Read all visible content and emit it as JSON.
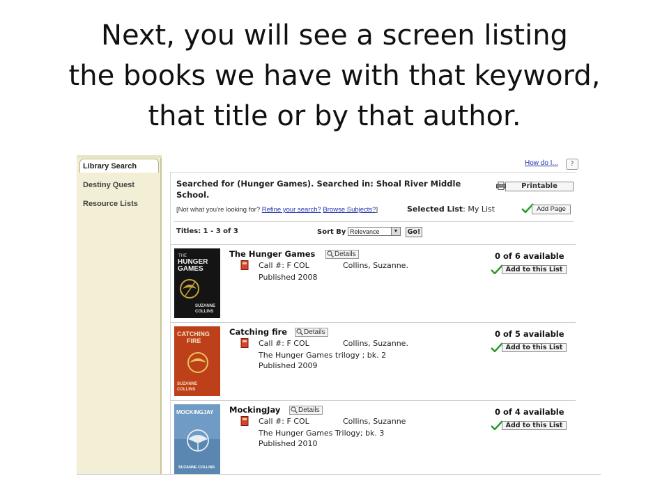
{
  "slide": {
    "title_lines": [
      "Next, you will see a screen listing",
      "the books we have with that keyword,",
      "that title or by that author."
    ]
  },
  "sidebar": {
    "items": [
      {
        "label": "Library Search",
        "active": true
      },
      {
        "label": "Destiny Quest"
      },
      {
        "label": "Resource Lists"
      }
    ]
  },
  "header": {
    "help_link": "How do I...",
    "help_icon": "?"
  },
  "search": {
    "searched_for": "Searched for (Hunger Games). Searched in: Shoal River Middle School.",
    "printable_label": "Printable",
    "not_what_prefix": "[Not what you're looking for? ",
    "refine_link": "Refine your search?",
    "browse_link": "Browse Subjects?",
    "not_what_suffix": "]",
    "selected_list_label": "Selected List",
    "selected_list_value": ": My List",
    "add_page_label": "Add Page",
    "titles_count": "Titles: 1 - 3 of 3",
    "sort_by_label": "Sort By",
    "sort_value": "Relevance",
    "go_label": "Go!"
  },
  "results": [
    {
      "title": "The Hunger Games",
      "details_label": "Details",
      "call_number": "Call #: F COL",
      "author": "Collins, Suzanne.",
      "series": "",
      "published": "Published 2008",
      "availability": "0 of 6 available",
      "add_label": "Add to this List",
      "cover": {
        "lines": [
          "THE",
          "HUNGER",
          "GAMES"
        ],
        "author": "SUZANNE COLLINS",
        "color": "#141414",
        "text_color": "#f2f2f2"
      }
    },
    {
      "title": "Catching fire",
      "details_label": "Details",
      "call_number": "Call #: F COL",
      "author": "Collins, Suzanne.",
      "series": "The Hunger Games trilogy ; bk. 2",
      "published": "Published 2009",
      "availability": "0 of 5 available",
      "add_label": "Add to this List",
      "cover": {
        "lines": [
          "CATCHING",
          "FIRE"
        ],
        "author": "SUZANNE COLLINS",
        "color": "#b3321b",
        "text_color": "#f4e2c0"
      }
    },
    {
      "title": "MockingJay",
      "details_label": "Details",
      "call_number": "Call #: F COL",
      "author": "Collins, Suzanne",
      "series": "The Hunger Games Trilogy; bk. 3",
      "published": "Published 2010",
      "availability": "0 of 4 available",
      "add_label": "Add to this List",
      "cover": {
        "lines": [
          "MOCKINGJAY"
        ],
        "author": "SUZANNE COLLINS",
        "color": "#6f9bc4",
        "text_color": "#ffffff"
      }
    }
  ]
}
